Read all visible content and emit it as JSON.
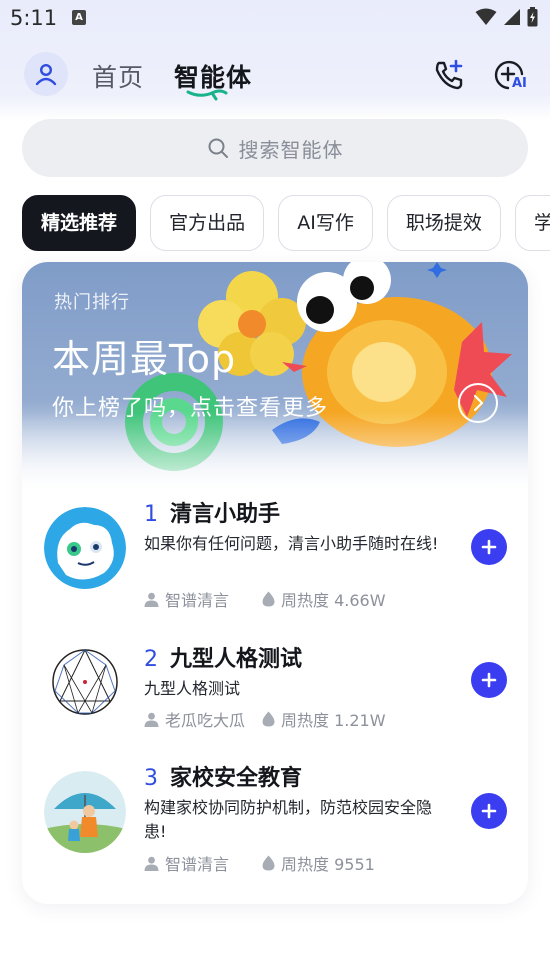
{
  "status_bar": {
    "time": "5:11",
    "notification_letter": "A"
  },
  "header": {
    "tab_home": "首页",
    "tab_agents": "智能体",
    "ai_badge": "AI"
  },
  "search": {
    "placeholder": "搜索智能体"
  },
  "chips": [
    "精选推荐",
    "官方出品",
    "AI写作",
    "职场提效",
    "学"
  ],
  "banner": {
    "tag": "热门排行",
    "title": "本周最Top",
    "subtitle": "你上榜了吗，点击查看更多"
  },
  "ranking": [
    {
      "rank": "1",
      "name": "清言小助手",
      "description": "如果你有任何问题，清言小助手随时在线!",
      "author": "智谱清言",
      "heat": "周热度 4.66W"
    },
    {
      "rank": "2",
      "name": "九型人格测试",
      "description": "九型人格测试",
      "author": "老瓜吃大瓜",
      "heat": "周热度 1.21W"
    },
    {
      "rank": "3",
      "name": "家校安全教育",
      "description": "构建家校协同防护机制，防范校园安全隐患!",
      "author": "智谱清言",
      "heat": "周热度 9551"
    }
  ],
  "colors": {
    "accent": "#3a3ef0",
    "rank": "#2f4de0",
    "chip_active": "#15171f"
  }
}
